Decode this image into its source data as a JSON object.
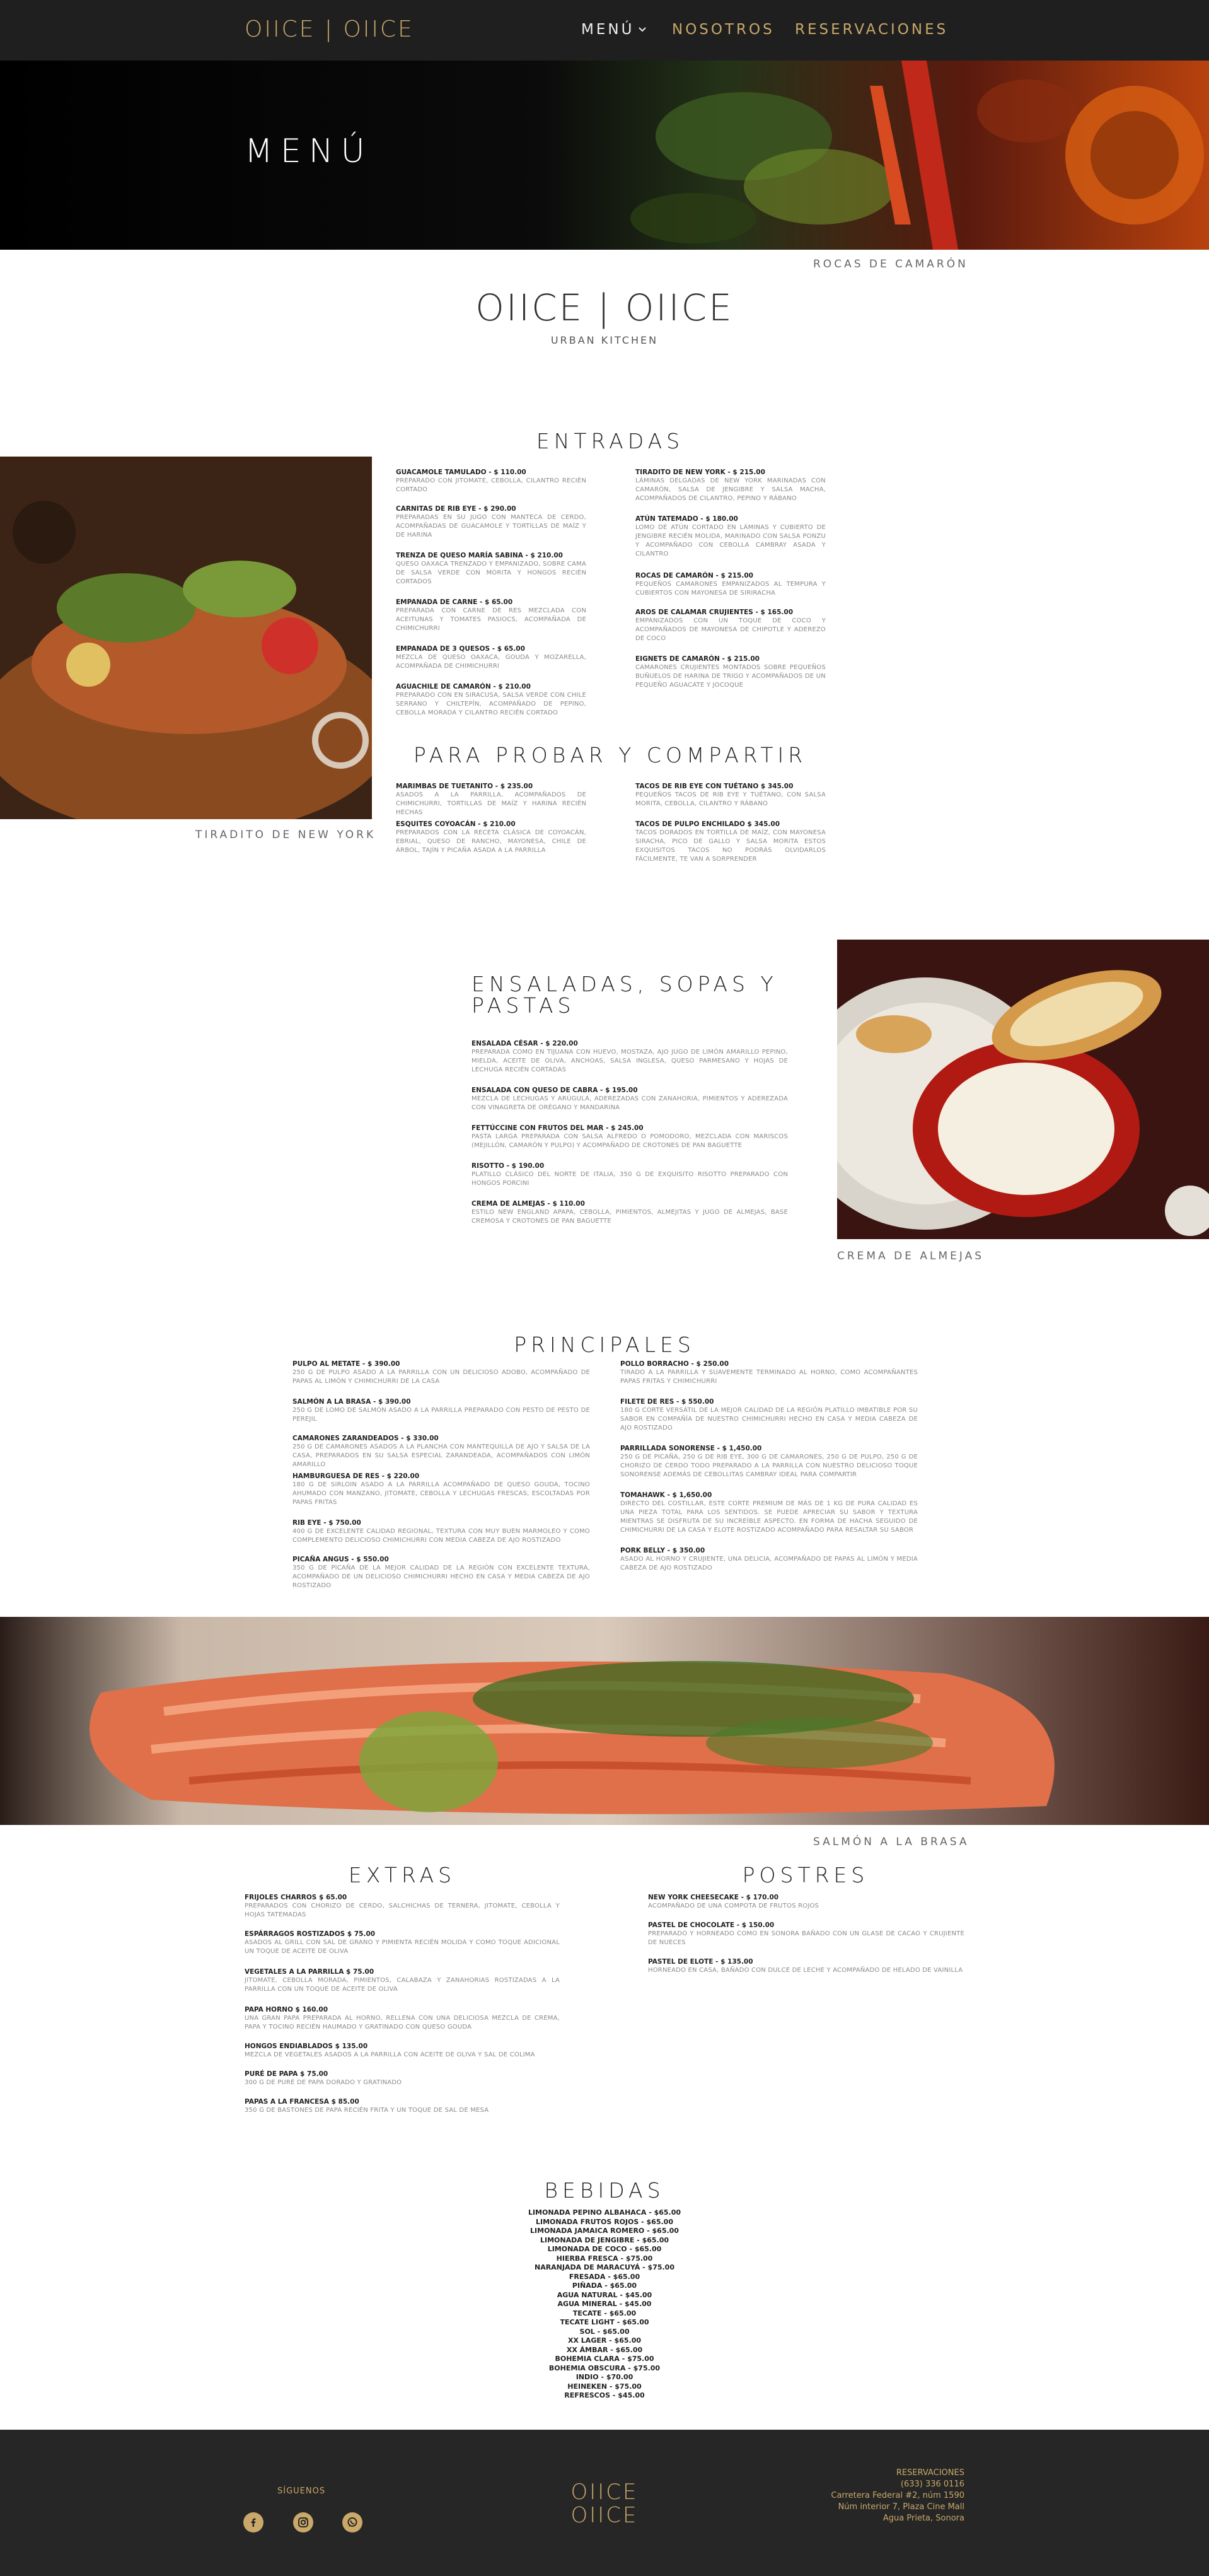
{
  "header": {
    "logo": "OIICE | OIICE",
    "nav": [
      {
        "label": "MENÚ"
      },
      {
        "label": "NOSOTROS"
      },
      {
        "label": "RESERVACIONES"
      }
    ]
  },
  "hero": {
    "title": "MENÚ",
    "caption": "ROCAS DE CAMARÓN"
  },
  "brand": {
    "logo": "OIICE | OIICE",
    "subtitle": "URBAN KITCHEN"
  },
  "entradas": {
    "title": "ENTRADAS",
    "image_caption": "TIRADITO DE NEW YORK",
    "left": [
      {
        "name": "GUACAMOLE TAMULADO - $ 110.00",
        "desc": "PREPARADO CON JITOMATE, CEBOLLA, CILANTRO RECIÉN CORTADO"
      },
      {
        "name": "CARNITAS DE RIB EYE - $ 290.00",
        "desc": "PREPARADAS EN SU JUGO CON MANTECA DE CERDO, ACOMPAÑADAS DE GUACAMOLE Y TORTILLAS DE MAÍZ Y DE HARINA"
      },
      {
        "name": "TRENZA DE QUESO MARÍA SABINA - $ 210.00",
        "desc": "QUESO OAXACA TRENZADO Y EMPANIZADO, SOBRE CAMA DE SALSA VERDE CON MORITA Y HONGOS RECIÉN CORTADOS"
      },
      {
        "name": "EMPANADA DE CARNE - $ 65.00",
        "desc": "PREPARADA CON CARNE DE RES MEZCLADA CON ACEITUNAS Y TOMATES PASIOCS, ACOMPAÑADA DE CHIMICHURRI"
      },
      {
        "name": "EMPANADA DE 3 QUESOS - $ 65.00",
        "desc": "MEZCLA DE QUESO OAXACA, GOUDA Y MOZARELLA, ACOMPAÑADA DE CHIMICHURRI"
      },
      {
        "name": "AGUACHILE DE CAMARÓN - $ 210.00",
        "desc": "PREPARADO CON EN SIRACUSA, SALSA VERDE CON CHILE SERRANO Y CHILTEPÍN, ACOMPAÑADO DE PEPINO, CEBOLLA MORADA Y CILANTRO RECIÉN CORTADO"
      }
    ],
    "right": [
      {
        "name": "TIRADITO DE NEW YORK - $ 215.00",
        "desc": "LÁMINAS DELGADAS DE NEW YORK MARINADAS CON CAMARÓN, SALSA DE JENGIBRE Y SALSA MACHA, ACOMPAÑADOS DE CILANTRO, PEPINO Y RÁBANO"
      },
      {
        "name": "ATÚN TATEMADO - $ 180.00",
        "desc": "LOMO DE ATÚN CORTADO EN LÁMINAS Y CUBIERTO DE JENGIBRE RECIÉN MOLIDA, MARINADO CON SALSA PONZU Y ACOMPAÑADO CON CEBOLLA CAMBRAY ASADA Y CILANTRO"
      },
      {
        "name": "ROCAS DE CAMARÓN - $ 215.00",
        "desc": "PEQUEÑOS CAMARONES EMPANIZADOS AL TEMPURA Y CUBIERTOS CON MAYONESA DE SIRIRACHA"
      },
      {
        "name": "AROS DE CALAMAR CRUJIENTES - $ 165.00",
        "desc": "EMPANIZADOS CON UN TOQUE DE COCO Y ACOMPAÑADOS DE MAYONESA DE CHIPOTLE Y ADEREZO DE COCO"
      },
      {
        "name": "EIGNETS DE CAMARÓN - $ 215.00",
        "desc": "CAMARONES CRUJIENTES MONTADOS SOBRE PEQUEÑOS BUÑUELOS DE HARINA DE TRIGO Y ACOMPAÑADOS DE UN PEQUEÑO AGUACATE Y JOCOQUE"
      }
    ]
  },
  "probar": {
    "title": "PARA PROBAR Y COMPARTIR",
    "left": [
      {
        "name": "MARIMBAS DE TUETANITO - $ 235.00",
        "desc": "ASADOS A LA PARRILLA, ACOMPAÑADOS DE CHIMICHURRI, TORTILLAS DE MAÍZ Y HARINA RECIÉN HECHAS"
      },
      {
        "name": "ESQUITES COYOACÁN - $ 210.00",
        "desc": "PREPARADOS CON LA RECETA CLÁSICA DE COYOACÁN, EBRIAL, QUESO DE RANCHO, MAYONESA, CHILE DE ÁRBOL, TAJÍN Y PICAÑA ASADA A LA PARRILLA"
      }
    ],
    "right": [
      {
        "name": "TACOS DE RIB EYE CON TUÉTANO $ 345.00",
        "desc": "PEQUEÑOS TACOS DE RIB EYE Y TUÉTANO, CON SALSA MORITA, CEBOLLA, CILANTRO Y RÁBANO"
      },
      {
        "name": "TACOS DE PULPO ENCHILADO $ 345.00",
        "desc": "TACOS DORADOS EN TORTILLA DE MAÍZ, CON MAYONESA SIRACHA, PICO DE GALLO Y SALSA MORITA ESTOS EXQUISITOS TACOS NO PODRÁS OLVIDARLOS FÁCILMENTE, TE VAN A SORPRENDER"
      }
    ]
  },
  "ensaladas": {
    "title_line1": "ENSALADAS, SOPAS Y",
    "title_line2": "PASTAS",
    "image_caption": "CREMA DE ALMEJAS",
    "items": [
      {
        "name": "ENSALADA CÉSAR - $ 220.00",
        "desc": "PREPARADA COMO EN TIJUANA CON HUEVO, MOSTAZA, AJO JUGO DE LIMÓN AMARILLO PEPINO, MIELDA, ACEITE DE OLIVA, ANCHOAS, SALSA INGLESA, QUESO PARMESANO Y HOJAS DE LECHUGA RECIÉN CORTADAS"
      },
      {
        "name": "ENSALADA CON QUESO DE CABRA - $ 195.00",
        "desc": "MEZCLA DE LECHUGAS Y ARÚGULA, ADEREZADAS CON ZANAHORIA, PIMIENTOS Y ADEREZADA CON VINAGRETA DE ORÉGANO Y MANDARINA"
      },
      {
        "name": "FETTÚCCINE CON FRUTOS DEL MAR - $ 245.00",
        "desc": "PASTA LARGA PREPARADA CON SALSA ALFREDO O POMODORO, MEZCLADA CON MARISCOS (MEJILLÓN, CAMARÓN Y PULPO) Y ACOMPAÑADO DE CROTONES DE PAN BAGUETTE"
      },
      {
        "name": "RISOTTO - $ 190.00",
        "desc": "PLATILLO CLÁSICO DEL NORTE DE ITALIA, 350 G DE EXQUISITO RISOTTO PREPARADO CON HONGOS PORCINI"
      },
      {
        "name": "CREMA DE ALMEJAS - $ 110.00",
        "desc": "ESTILO NEW ENGLAND APAPA, CEBOLLA, PIMIENTOS, ALMEJITAS Y JUGO DE ALMEJAS, BASE CREMOSA Y CROTONES DE PAN BAGUETTE"
      }
    ]
  },
  "principales": {
    "title": "PRINCIPALES",
    "left": [
      {
        "name": "PULPO AL METATE - $ 390.00",
        "desc": "250 G DE PULPO ASADO A LA PARRILLA CON UN DELICIOSO ADOBO, ACOMPAÑADO DE PAPAS AL LIMÓN Y CHIMICHURRI DE LA CASA"
      },
      {
        "name": "SALMÓN A LA BRASA - $ 390.00",
        "desc": "250 G DE LOMO DE SALMÓN ASADO A LA PARRILLA PREPARADO CON PESTO DE PESTO DE PEREJIL"
      },
      {
        "name": "CAMARONES ZARANDEADOS - $ 330.00",
        "desc": "250 G DE CAMARONES ASADOS A LA PLANCHA CON MANTEQUILLA DE AJO Y SALSA DE LA CASA, PREPARADOS EN SU SALSA ESPECIAL ZARANDEADA, ACOMPAÑADOS CON LIMÓN AMARILLO"
      },
      {
        "name": "HAMBURGUESA DE RES - $ 220.00",
        "desc": "180 G DE SIRLOIN ASADO A LA PARRILLA ACOMPAÑADO DE QUESO GOUDA, TOCINO AHUMADO CON MANZANO, JITOMATE, CEBOLLA Y LECHUGAS FRESCAS, ESCOLTADAS POR PAPAS FRITAS"
      },
      {
        "name": "RIB EYE - $ 750.00",
        "desc": "400 G DE EXCELENTE CALIDAD REGIONAL, TEXTURA CON MUY BUEN MARMOLEO Y COMO COMPLEMENTO DELICIOSO CHIMICHURRI CON MEDIA CABEZA DE AJO ROSTIZADO"
      },
      {
        "name": "PICAÑA ANGUS - $ 550.00",
        "desc": "350 G DE PICAÑA DE LA MEJOR CALIDAD DE LA REGIÓN CON EXCELENTE TEXTURA, ACOMPAÑADO DE UN DELICIOSO CHIMICHURRI HECHO EN CASA Y MEDIA CABEZA DE AJO ROSTIZADO"
      }
    ],
    "right": [
      {
        "name": "POLLO BORRACHO - $ 250.00",
        "desc": "TIRADO A LA PARRILLA Y SUAVEMENTE TERMINADO AL HORNO, COMO ACOMPAÑANTES PAPAS FRITAS Y CHIMICHURRI"
      },
      {
        "name": "FILETE DE RES - $ 550.00",
        "desc": "180 G CORTE VERSÁTIL DE LA MEJOR CALIDAD DE LA REGIÓN PLATILLO IMBATIBLE POR SU SABOR EN COMPAÑÍA DE NUESTRO CHIMICHURRI HECHO EN CASA Y MEDIA CABEZA DE AJO ROSTIZADO"
      },
      {
        "name": "PARRILLADA SONORENSE - $ 1,450.00",
        "desc": "250 G DE PICAÑA, 250 G DE RIB EYE, 300 G DE CAMARONES, 250 G DE PULPO, 250 G DE CHORIZO DE CERDO TODO PREPARADO A LA PARRILLA CON NUESTRO DELICIOSO TOQUE SONORENSE ADEMÁS DE CEBOLLITAS CAMBRAY IDEAL PARA COMPARTIR"
      },
      {
        "name": "TOMAHAWK - $ 1,650.00",
        "desc": "DIRECTO DEL COSTILLAR, ESTE CORTE PREMIUM DE MÁS DE 1 KG DE PURA CALIDAD ES UNA PIEZA TOTAL PARA LOS SENTIDOS. SE PUEDE APRECIAR SU SABOR Y TEXTURA MIENTRAS SE DISFRUTA DE SU INCREÍBLE ASPECTO. EN FORMA DE HACHA SEGUIDO DE CHIMICHURRI DE LA CASA Y ELOTE ROSTIZADO ACOMPAÑADO PARA RESALTAR SU SABOR"
      },
      {
        "name": "PORK BELLY - $ 350.00",
        "desc": "ASADO AL HORNO Y CRUJIENTE, UNA DELICIA, ACOMPAÑADO DE PAPAS AL LIMÓN Y MEDIA CABEZA DE AJO ROSTIZADO"
      }
    ]
  },
  "salmon_caption": "SALMÓN A LA BRASA",
  "extras": {
    "title": "EXTRAS",
    "items": [
      {
        "name": "FRIJOLES CHARROS $ 65.00",
        "desc": "PREPARADOS CON CHORIZO DE CERDO, SALCHICHAS DE TERNERA, JITOMATE, CEBOLLA Y HOJAS TATEMADAS"
      },
      {
        "name": "ESPÁRRAGOS ROSTIZADOS $ 75.00",
        "desc": "ASADOS AL GRILL CON SAL DE GRANO Y PIMIENTA RECIÉN MOLIDA Y COMO TOQUE ADICIONAL UN TOQUE DE ACEITE DE OLIVA"
      },
      {
        "name": "VEGETALES A LA PARRILLA $ 75.00",
        "desc": "JITOMATE, CEBOLLA MORADA, PIMIENTOS, CALABAZA Y ZANAHORIAS ROSTIZADAS A LA PARRILLA CON UN TOQUE DE ACEITE DE OLIVA"
      },
      {
        "name": "PAPA HORNO $ 160.00",
        "desc": "UNA GRAN PAPA PREPARADA AL HORNO, RELLENA CON UNA DELICIOSA MEZCLA DE CREMA, PAPA Y TOCINO RECIÉN HAUMADO Y GRATINADO CON QUESO GOUDA"
      },
      {
        "name": "HONGOS ENDIABLADOS $ 135.00",
        "desc": "MEZCLA DE VEGETALES ASADOS A LA PARRILLA CON ACEITE DE OLIVA Y SAL DE COLIMA"
      },
      {
        "name": "PURÉ DE PAPA $ 75.00",
        "desc": "300 G DE PURÉ DE PAPA DORADO Y GRATINADO"
      },
      {
        "name": "PAPAS A LA FRANCESA $ 85.00",
        "desc": "350 G DE BASTONES DE PAPA RECIÉN FRITA Y UN TOQUE DE SAL DE MESA"
      }
    ]
  },
  "postres": {
    "title": "POSTRES",
    "items": [
      {
        "name": "NEW YORK CHEESECAKE - $ 170.00",
        "desc": "ACOMPAÑADO DE UNA COMPOTA DE FRUTOS ROJOS"
      },
      {
        "name": "PASTEL DE CHOCOLATE - $ 150.00",
        "desc": "PREPARADO Y HORNEADO COMO EN SONORA BAÑADO CON UN GLASE DE CACAO Y CRUJIENTE DE NUECES"
      },
      {
        "name": "PASTEL DE ELOTE - $ 135.00",
        "desc": "HORNEADO EN CASA, BAÑADO CON DULCE DE LECHE Y ACOMPAÑADO DE HELADO DE VAINILLA"
      }
    ]
  },
  "bebidas": {
    "title": "BEBIDAS",
    "items": [
      "LIMONADA PEPINO ALBAHACA - $65.00",
      "LIMONADA FRUTOS ROJOS - $65.00",
      "LIMONADA JAMAICA ROMERO - $65.00",
      "LIMONADA DE JENGIBRE - $65.00",
      "LIMONADA DE COCO - $65.00",
      "HIERBA FRESCA - $75.00",
      "NARANJADA DE MARACUYÁ - $75.00",
      "FRESADA - $65.00",
      "PIÑADA - $65.00",
      "AGUA NATURAL - $45.00",
      "AGUA MINERAL - $45.00",
      "TECATE - $65.00",
      "TECATE LIGHT - $65.00",
      "SOL - $65.00",
      "XX LAGER - $65.00",
      "XX ÁMBAR - $65.00",
      "BOHEMIA CLARA - $75.00",
      "BOHEMIA OBSCURA - $75.00",
      "INDIO - $70.00",
      "HEINEKEN - $75.00",
      "REFRESCOS - $45.00"
    ]
  },
  "footer": {
    "follow_label": "SÍGUENOS",
    "logo_top": "OIICE",
    "logo_bottom": "OIICE",
    "reservations_label": "RESERVACIONES",
    "phone": "(633) 336 0116",
    "address_lines": [
      "Carretera Federal #2, núm 1590",
      "Núm interior 7, Plaza Cine Mall",
      "Agua Prieta, Sonora"
    ]
  },
  "colors": {
    "accent": "#c9a86a",
    "dark": "#1f1f1f",
    "footer": "#262626"
  },
  "icons": [
    "chevron-down-icon",
    "facebook-icon",
    "instagram-icon",
    "whatsapp-icon"
  ]
}
